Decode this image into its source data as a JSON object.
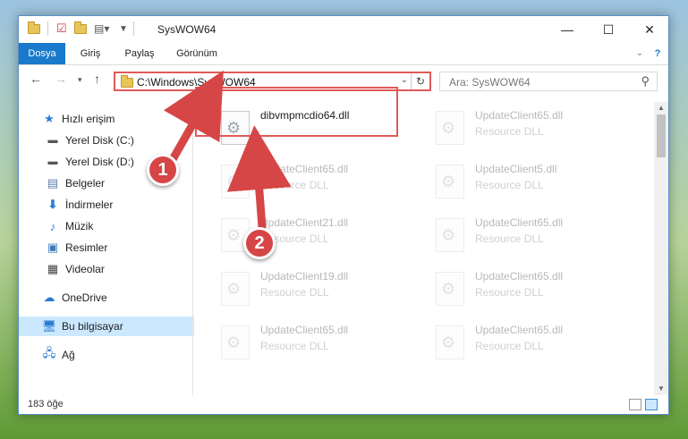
{
  "window": {
    "title": "SysWOW64",
    "controls": {
      "minimize": "—",
      "maximize": "☐",
      "close": "✕"
    },
    "help": "?"
  },
  "ribbon": {
    "tabs": [
      {
        "label": "Dosya",
        "active": true
      },
      {
        "label": "Giriş"
      },
      {
        "label": "Paylaş"
      },
      {
        "label": "Görünüm"
      }
    ]
  },
  "address": {
    "path": "C:\\Windows\\SysWOW64"
  },
  "search": {
    "placeholder": "Ara: SysWOW64"
  },
  "nav": {
    "items": [
      {
        "label": "Hızlı erişim",
        "icon": "star-icon"
      },
      {
        "label": "Yerel Disk (C:)",
        "icon": "drive-icon",
        "pinned": true
      },
      {
        "label": "Yerel Disk (D:)",
        "icon": "drive-icon",
        "pinned": true
      },
      {
        "label": "Belgeler",
        "icon": "documents-icon",
        "pinned": true
      },
      {
        "label": "İndirmeler",
        "icon": "download-icon",
        "pinned": true
      },
      {
        "label": "Müzik",
        "icon": "music-icon",
        "pinned": true
      },
      {
        "label": "Resimler",
        "icon": "pictures-icon",
        "pinned": true
      },
      {
        "label": "Videolar",
        "icon": "videos-icon",
        "pinned": true
      },
      {
        "label": "OneDrive",
        "icon": "cloud-icon"
      },
      {
        "label": "Bu bilgisayar",
        "icon": "computer-icon",
        "selected": true
      },
      {
        "label": "Ağ",
        "icon": "network-icon"
      }
    ]
  },
  "files": [
    {
      "name": "dibvmpmcdio64.dll",
      "type": "",
      "highlight": true
    },
    {
      "name": "UpdateClient65.dll",
      "type": "Resource DLL"
    },
    {
      "name": "UpdateClient65.dll",
      "type": "Resource DLL"
    },
    {
      "name": "UpdateClient5.dll",
      "type": "Resource DLL"
    },
    {
      "name": "UpdateClient21.dll",
      "type": "Resource DLL"
    },
    {
      "name": "UpdateClient65.dll",
      "type": "Resource DLL"
    },
    {
      "name": "UpdateClient19.dll",
      "type": "Resource DLL"
    },
    {
      "name": "UpdateClient65.dll",
      "type": "Resource DLL"
    },
    {
      "name": "UpdateClient65.dll",
      "type": "Resource DLL"
    },
    {
      "name": "UpdateClient65.dll",
      "type": "Resource DLL"
    }
  ],
  "status": {
    "count": "183 öğe"
  },
  "annotations": {
    "callout1": "1",
    "callout2": "2"
  },
  "colors": {
    "accent": "#1979ca",
    "annotation": "#d64646",
    "selection": "#cce8ff"
  }
}
